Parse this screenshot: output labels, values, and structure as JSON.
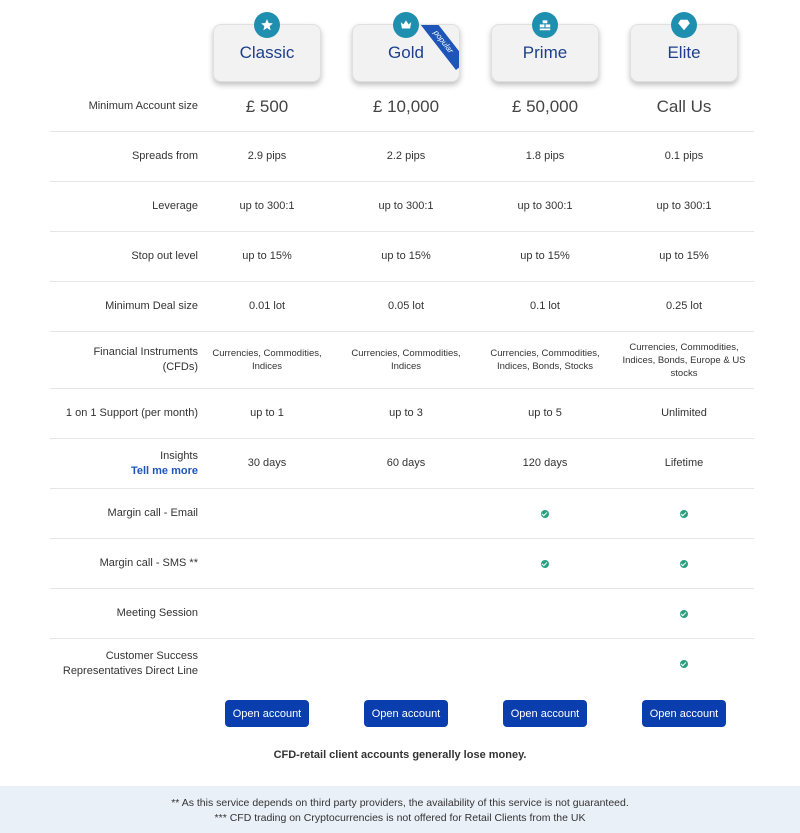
{
  "plans": [
    {
      "name": "Classic",
      "icon": "star-icon"
    },
    {
      "name": "Gold",
      "icon": "crown-icon",
      "ribbon": "popular"
    },
    {
      "name": "Prime",
      "icon": "bars-icon"
    },
    {
      "name": "Elite",
      "icon": "diamond-icon"
    }
  ],
  "rows": [
    {
      "label": "Minimum Account size",
      "values": [
        "£ 500",
        "£ 10,000",
        "£ 50,000",
        "Call Us"
      ]
    },
    {
      "label": "Spreads from",
      "values": [
        "2.9 pips",
        "2.2 pips",
        "1.8 pips",
        "0.1 pips"
      ]
    },
    {
      "label": "Leverage",
      "values": [
        "up to 300:1",
        "up to 300:1",
        "up to 300:1",
        "up to 300:1"
      ]
    },
    {
      "label": "Stop out level",
      "values": [
        "up to 15%",
        "up to 15%",
        "up to 15%",
        "up to 15%"
      ]
    },
    {
      "label": "Minimum Deal size",
      "values": [
        "0.01 lot",
        "0.05 lot",
        "0.1 lot",
        "0.25 lot"
      ]
    },
    {
      "label": "Financial Instruments (CFDs)",
      "values": [
        "Currencies, Commodities, Indices",
        "Currencies, Commodities, Indices",
        "Currencies, Commodities, Indices, Bonds, Stocks",
        "Currencies, Commodities, Indices, Bonds, Europe & US stocks"
      ]
    },
    {
      "label": "1 on 1 Support (per month)",
      "values": [
        "up to 1",
        "up to 3",
        "up to 5",
        "Unlimited"
      ]
    },
    {
      "label": "Insights",
      "link": "Tell me more",
      "values": [
        "30 days",
        "60 days",
        "120 days",
        "Lifetime"
      ]
    },
    {
      "label": "Margin call - Email",
      "checks": [
        false,
        false,
        true,
        true
      ]
    },
    {
      "label": "Margin call - SMS **",
      "checks": [
        false,
        false,
        true,
        true
      ]
    },
    {
      "label": "Meeting Session",
      "checks": [
        false,
        false,
        false,
        true
      ]
    },
    {
      "label": "Customer Success Representatives Direct Line",
      "checks": [
        false,
        false,
        false,
        true
      ]
    }
  ],
  "open_button_label": "Open account",
  "risk_warning": "CFD-retail client accounts generally lose money.",
  "footer": {
    "note1": "** As this service depends on third party providers, the availability of this service is not guaranteed.",
    "note2": "*** CFD trading on Cryptocurrencies is not offered for Retail Clients from the UK"
  },
  "colors": {
    "accent": "#0a3dad",
    "plan_text": "#1d3f8c",
    "icon_bg": "#1f8fb0",
    "check": "#2ba080"
  }
}
